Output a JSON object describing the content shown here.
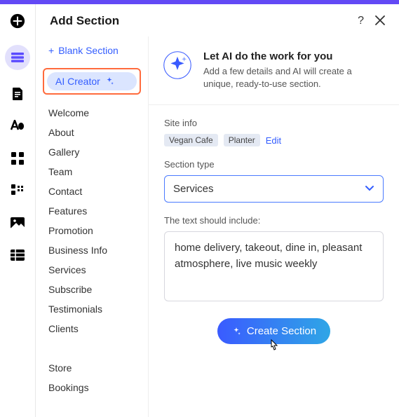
{
  "header": {
    "title": "Add Section"
  },
  "sidebar": {
    "blank": "Blank Section",
    "ai": "AI Creator",
    "groupA": [
      "Welcome",
      "About",
      "Gallery",
      "Team",
      "Contact",
      "Features",
      "Promotion",
      "Business Info",
      "Services",
      "Subscribe",
      "Testimonials",
      "Clients"
    ],
    "groupB": [
      "Store",
      "Bookings"
    ]
  },
  "hero": {
    "title": "Let AI do the work for you",
    "subtitle": "Add a few details and AI will create a unique, ready-to-use section."
  },
  "siteInfo": {
    "label": "Site info",
    "tags": [
      "Vegan Cafe",
      "Planter"
    ],
    "edit": "Edit"
  },
  "sectionType": {
    "label": "Section type",
    "value": "Services"
  },
  "includeText": {
    "label": "The text should include:",
    "value": "home delivery, takeout, dine in, pleasant atmosphere, live music weekly"
  },
  "cta": "Create Section"
}
